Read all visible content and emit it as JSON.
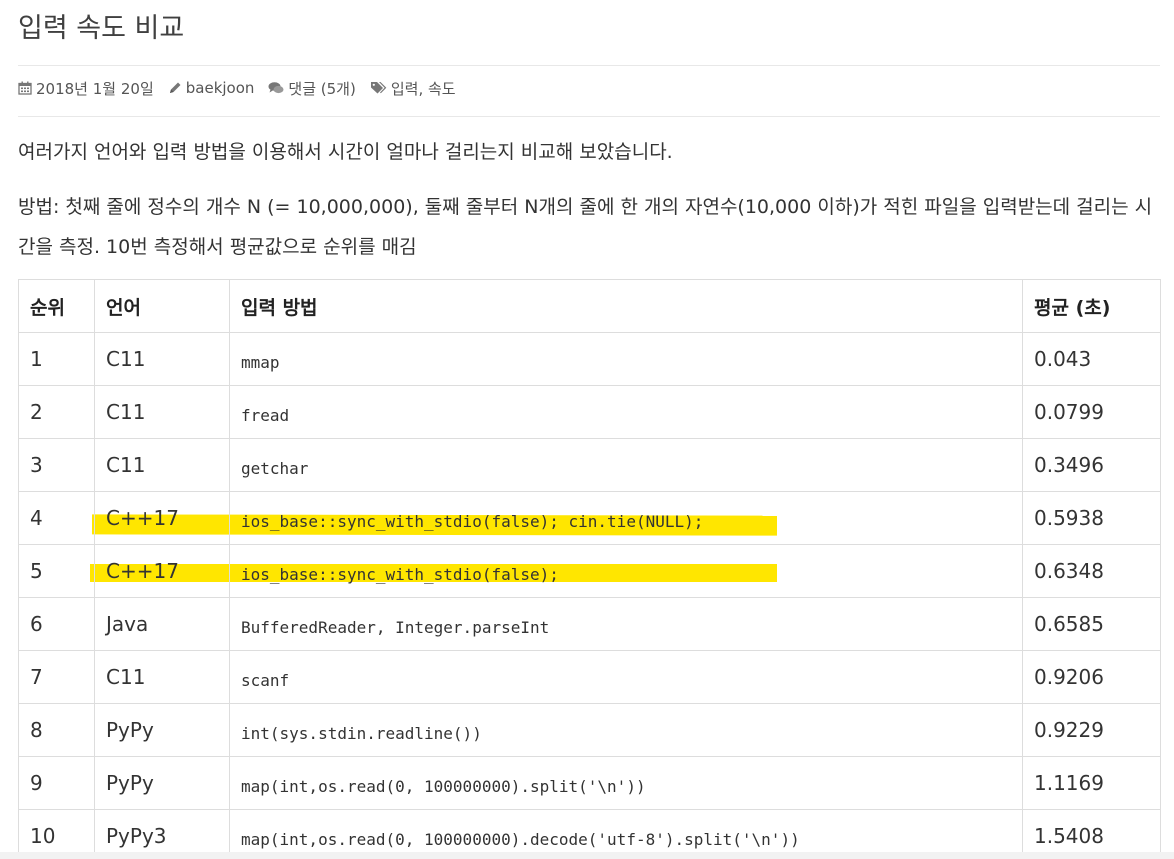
{
  "post": {
    "title": "입력 속도 비교",
    "date": "2018년 1월 20일",
    "author": "baekjoon",
    "comments": "댓글 (5개)",
    "tags": "입력, 속도",
    "paragraph1": "여러가지 언어와 입력 방법을 이용해서 시간이 얼마나 걸리는지 비교해 보았습니다.",
    "paragraph2": "방법: 첫째 줄에 정수의 개수 N (= 10,000,000), 둘째 줄부터 N개의 줄에 한 개의 자연수(10,000 이하)가 적힌 파일을 입력받는데 걸리는 시간을 측정. 10번 측정해서 평균값으로 순위를 매김"
  },
  "icons": {
    "date": "calendar-icon",
    "author": "pencil-icon",
    "comments": "comments-icon",
    "tags": "tags-icon"
  },
  "highlight_color": "#ffe600",
  "table": {
    "headers": [
      "순위",
      "언어",
      "입력 방법",
      "평균 (초)"
    ],
    "rows": [
      {
        "rank": "1",
        "lang": "C11",
        "method": "mmap",
        "time": "0.043"
      },
      {
        "rank": "2",
        "lang": "C11",
        "method": "fread",
        "time": "0.0799"
      },
      {
        "rank": "3",
        "lang": "C11",
        "method": "getchar",
        "time": "0.3496"
      },
      {
        "rank": "4",
        "lang": "C++17",
        "method": "ios_base::sync_with_stdio(false); cin.tie(NULL);",
        "time": "0.5938"
      },
      {
        "rank": "5",
        "lang": "C++17",
        "method": "ios_base::sync_with_stdio(false);",
        "time": "0.6348"
      },
      {
        "rank": "6",
        "lang": "Java",
        "method": "BufferedReader, Integer.parseInt",
        "time": "0.6585"
      },
      {
        "rank": "7",
        "lang": "C11",
        "method": "scanf",
        "time": "0.9206"
      },
      {
        "rank": "8",
        "lang": "PyPy",
        "method": "int(sys.stdin.readline())",
        "time": "0.9229"
      },
      {
        "rank": "9",
        "lang": "PyPy",
        "method": "map(int,os.read(0, 100000000).split('\\n'))",
        "time": "1.1169"
      },
      {
        "rank": "10",
        "lang": "PyPy3",
        "method": "map(int,os.read(0, 100000000).decode('utf-8').split('\\n'))",
        "time": "1.5408"
      }
    ]
  }
}
